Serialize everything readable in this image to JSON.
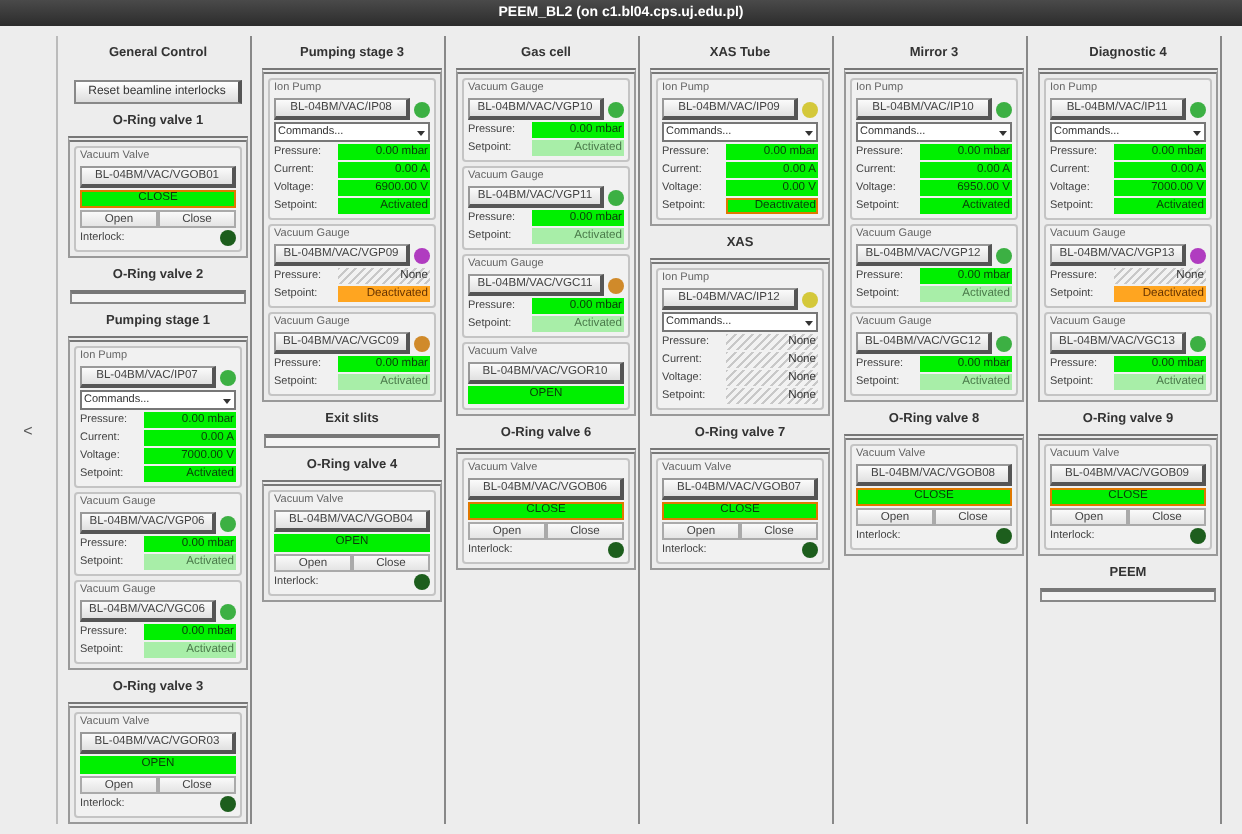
{
  "window": {
    "title": "PEEM_BL2 (on c1.bl04.cps.uj.edu.pl)"
  },
  "nav": {
    "left": "<"
  },
  "columns": [
    {
      "sections": [
        {
          "title": "General Control",
          "kind": "buttons",
          "buttons": [
            "Reset beamline interlocks"
          ]
        },
        {
          "title": "O-Ring valve 1",
          "kind": "devices",
          "devices": [
            {
              "kind": "valve",
              "label": "Vacuum Valve",
              "name": "BL-04BM/VAC/VGOB01",
              "status": "CLOSE",
              "flagged": true,
              "buttons": [
                "Open",
                "Close"
              ],
              "interlock": {
                "label": "Interlock:",
                "color": "#1d5e1d"
              }
            }
          ]
        },
        {
          "title": "O-Ring valve 2",
          "kind": "empty"
        },
        {
          "title": "Pumping stage 1",
          "kind": "devices",
          "devices": [
            {
              "kind": "ion_pump",
              "label": "Ion Pump",
              "name": "BL-04BM/VAC/IP07",
              "color": "#3cb043",
              "command": "Commands...",
              "readings": [
                {
                  "label": "Pressure:",
                  "value": "0.00 mbar",
                  "kind": "on",
                  "flagged": false
                },
                {
                  "label": "Current:",
                  "value": "0.00 A",
                  "kind": "on",
                  "flagged": false
                },
                {
                  "label": "Voltage:",
                  "value": "7000.00 V",
                  "kind": "on",
                  "flagged": false
                },
                {
                  "label": "Setpoint:",
                  "value": "Activated",
                  "kind": "on",
                  "flagged": false
                }
              ]
            },
            {
              "kind": "gauge",
              "label": "Vacuum Gauge",
              "name": "BL-04BM/VAC/VGP06",
              "color": "#3cb043",
              "readings": [
                {
                  "label": "Pressure:",
                  "value": "0.00 mbar",
                  "kind": "on",
                  "flagged": false
                },
                {
                  "label": "Setpoint:",
                  "value": "Activated",
                  "kind": "dim",
                  "flagged": false
                }
              ]
            },
            {
              "kind": "gauge",
              "label": "Vacuum Gauge",
              "name": "BL-04BM/VAC/VGC06",
              "color": "#3cb043",
              "readings": [
                {
                  "label": "Pressure:",
                  "value": "0.00 mbar",
                  "kind": "on",
                  "flagged": false
                },
                {
                  "label": "Setpoint:",
                  "value": "Activated",
                  "kind": "dim",
                  "flagged": false
                }
              ]
            }
          ]
        },
        {
          "title": "O-Ring valve 3",
          "kind": "devices",
          "devices": [
            {
              "kind": "valve",
              "label": "Vacuum Valve",
              "name": "BL-04BM/VAC/VGOR03",
              "status": "OPEN",
              "flagged": false,
              "buttons": [
                "Open",
                "Close"
              ],
              "interlock": {
                "label": "Interlock:",
                "color": "#1d5e1d"
              }
            }
          ]
        }
      ]
    },
    {
      "sections": [
        {
          "title": "Pumping stage 3",
          "kind": "devices",
          "devices": [
            {
              "kind": "ion_pump",
              "label": "Ion Pump",
              "name": "BL-04BM/VAC/IP08",
              "color": "#3cb043",
              "command": "Commands...",
              "readings": [
                {
                  "label": "Pressure:",
                  "value": "0.00 mbar",
                  "kind": "on",
                  "flagged": false
                },
                {
                  "label": "Current:",
                  "value": "0.00 A",
                  "kind": "on",
                  "flagged": false
                },
                {
                  "label": "Voltage:",
                  "value": "6900.00 V",
                  "kind": "on",
                  "flagged": false
                },
                {
                  "label": "Setpoint:",
                  "value": "Activated",
                  "kind": "on",
                  "flagged": false
                }
              ]
            },
            {
              "kind": "gauge",
              "label": "Vacuum Gauge",
              "name": "BL-04BM/VAC/VGP09",
              "color": "#b03cc0",
              "readings": [
                {
                  "label": "Pressure:",
                  "value": "None",
                  "kind": "none",
                  "flagged": false
                },
                {
                  "label": "Setpoint:",
                  "value": "Deactivated",
                  "kind": "alarm",
                  "flagged": false
                }
              ]
            },
            {
              "kind": "gauge",
              "label": "Vacuum Gauge",
              "name": "BL-04BM/VAC/VGC09",
              "color": "#d08a2a",
              "readings": [
                {
                  "label": "Pressure:",
                  "value": "0.00 mbar",
                  "kind": "on",
                  "flagged": false
                },
                {
                  "label": "Setpoint:",
                  "value": "Activated",
                  "kind": "dim",
                  "flagged": false
                }
              ]
            }
          ]
        },
        {
          "title": "Exit slits",
          "kind": "empty"
        },
        {
          "title": "O-Ring valve 4",
          "kind": "devices",
          "devices": [
            {
              "kind": "valve",
              "label": "Vacuum Valve",
              "name": "BL-04BM/VAC/VGOB04",
              "status": "OPEN",
              "flagged": false,
              "buttons": [
                "Open",
                "Close"
              ],
              "interlock": {
                "label": "Interlock:",
                "color": "#1d5e1d"
              }
            }
          ]
        }
      ]
    },
    {
      "sections": [
        {
          "title": "Gas cell",
          "kind": "devices",
          "devices": [
            {
              "kind": "gauge",
              "label": "Vacuum Gauge",
              "name": "BL-04BM/VAC/VGP10",
              "color": "#3cb043",
              "readings": [
                {
                  "label": "Pressure:",
                  "value": "0.00 mbar",
                  "kind": "on",
                  "flagged": false
                },
                {
                  "label": "Setpoint:",
                  "value": "Activated",
                  "kind": "dim",
                  "flagged": false
                }
              ]
            },
            {
              "kind": "gauge",
              "label": "Vacuum Gauge",
              "name": "BL-04BM/VAC/VGP11",
              "color": "#3cb043",
              "readings": [
                {
                  "label": "Pressure:",
                  "value": "0.00 mbar",
                  "kind": "on",
                  "flagged": false
                },
                {
                  "label": "Setpoint:",
                  "value": "Activated",
                  "kind": "dim",
                  "flagged": false
                }
              ]
            },
            {
              "kind": "gauge",
              "label": "Vacuum Gauge",
              "name": "BL-04BM/VAC/VGC11",
              "color": "#d08a2a",
              "readings": [
                {
                  "label": "Pressure:",
                  "value": "0.00 mbar",
                  "kind": "on",
                  "flagged": false
                },
                {
                  "label": "Setpoint:",
                  "value": "Activated",
                  "kind": "dim",
                  "flagged": false
                }
              ]
            },
            {
              "kind": "valve",
              "label": "Vacuum Valve",
              "name": "BL-04BM/VAC/VGOR10",
              "status": "OPEN",
              "flagged": false
            }
          ]
        },
        {
          "title": "O-Ring valve 6",
          "kind": "devices",
          "devices": [
            {
              "kind": "valve",
              "label": "Vacuum Valve",
              "name": "BL-04BM/VAC/VGOB06",
              "status": "CLOSE",
              "flagged": true,
              "buttons": [
                "Open",
                "Close"
              ],
              "interlock": {
                "label": "Interlock:",
                "color": "#1d5e1d"
              }
            }
          ]
        }
      ]
    },
    {
      "sections": [
        {
          "title": "XAS Tube",
          "kind": "devices",
          "devices": [
            {
              "kind": "ion_pump",
              "label": "Ion Pump",
              "name": "BL-04BM/VAC/IP09",
              "color": "#d4c83a",
              "command": "Commands...",
              "readings": [
                {
                  "label": "Pressure:",
                  "value": "0.00 mbar",
                  "kind": "on",
                  "flagged": false
                },
                {
                  "label": "Current:",
                  "value": "0.00 A",
                  "kind": "on",
                  "flagged": false
                },
                {
                  "label": "Voltage:",
                  "value": "0.00 V",
                  "kind": "on",
                  "flagged": false
                },
                {
                  "label": "Setpoint:",
                  "value": "Deactivated",
                  "kind": "on",
                  "flagged": true
                }
              ]
            }
          ]
        },
        {
          "title": "XAS",
          "kind": "devices",
          "devices": [
            {
              "kind": "ion_pump",
              "label": "Ion Pump",
              "name": "BL-04BM/VAC/IP12",
              "color": "#d4c83a",
              "command": "Commands...",
              "readings": [
                {
                  "label": "Pressure:",
                  "value": "None",
                  "kind": "none",
                  "flagged": false
                },
                {
                  "label": "Current:",
                  "value": "None",
                  "kind": "none",
                  "flagged": false
                },
                {
                  "label": "Voltage:",
                  "value": "None",
                  "kind": "none",
                  "flagged": false
                },
                {
                  "label": "Setpoint:",
                  "value": "None",
                  "kind": "none",
                  "flagged": false
                }
              ]
            }
          ]
        },
        {
          "title": "O-Ring valve 7",
          "kind": "devices",
          "devices": [
            {
              "kind": "valve",
              "label": "Vacuum Valve",
              "name": "BL-04BM/VAC/VGOB07",
              "status": "CLOSE",
              "flagged": true,
              "buttons": [
                "Open",
                "Close"
              ],
              "interlock": {
                "label": "Interlock:",
                "color": "#1d5e1d"
              }
            }
          ]
        }
      ]
    },
    {
      "sections": [
        {
          "title": "Mirror 3",
          "kind": "devices",
          "devices": [
            {
              "kind": "ion_pump",
              "label": "Ion Pump",
              "name": "BL-04BM/VAC/IP10",
              "color": "#3cb043",
              "command": "Commands...",
              "readings": [
                {
                  "label": "Pressure:",
                  "value": "0.00 mbar",
                  "kind": "on",
                  "flagged": false
                },
                {
                  "label": "Current:",
                  "value": "0.00 A",
                  "kind": "on",
                  "flagged": false
                },
                {
                  "label": "Voltage:",
                  "value": "6950.00 V",
                  "kind": "on",
                  "flagged": false
                },
                {
                  "label": "Setpoint:",
                  "value": "Activated",
                  "kind": "on",
                  "flagged": false
                }
              ]
            },
            {
              "kind": "gauge",
              "label": "Vacuum Gauge",
              "name": "BL-04BM/VAC/VGP12",
              "color": "#3cb043",
              "readings": [
                {
                  "label": "Pressure:",
                  "value": "0.00 mbar",
                  "kind": "on",
                  "flagged": false
                },
                {
                  "label": "Setpoint:",
                  "value": "Activated",
                  "kind": "dim",
                  "flagged": false
                }
              ]
            },
            {
              "kind": "gauge",
              "label": "Vacuum Gauge",
              "name": "BL-04BM/VAC/VGC12",
              "color": "#3cb043",
              "readings": [
                {
                  "label": "Pressure:",
                  "value": "0.00 mbar",
                  "kind": "on",
                  "flagged": false
                },
                {
                  "label": "Setpoint:",
                  "value": "Activated",
                  "kind": "dim",
                  "flagged": false
                }
              ]
            }
          ]
        },
        {
          "title": "O-Ring valve 8",
          "kind": "devices",
          "devices": [
            {
              "kind": "valve",
              "label": "Vacuum Valve",
              "name": "BL-04BM/VAC/VGOB08",
              "status": "CLOSE",
              "flagged": true,
              "buttons": [
                "Open",
                "Close"
              ],
              "interlock": {
                "label": "Interlock:",
                "color": "#1d5e1d"
              }
            }
          ]
        }
      ]
    },
    {
      "sections": [
        {
          "title": "Diagnostic 4",
          "kind": "devices",
          "devices": [
            {
              "kind": "ion_pump",
              "label": "Ion Pump",
              "name": "BL-04BM/VAC/IP11",
              "color": "#3cb043",
              "command": "Commands...",
              "readings": [
                {
                  "label": "Pressure:",
                  "value": "0.00 mbar",
                  "kind": "on",
                  "flagged": false
                },
                {
                  "label": "Current:",
                  "value": "0.00 A",
                  "kind": "on",
                  "flagged": false
                },
                {
                  "label": "Voltage:",
                  "value": "7000.00 V",
                  "kind": "on",
                  "flagged": false
                },
                {
                  "label": "Setpoint:",
                  "value": "Activated",
                  "kind": "on",
                  "flagged": false
                }
              ]
            },
            {
              "kind": "gauge",
              "label": "Vacuum Gauge",
              "name": "BL-04BM/VAC/VGP13",
              "color": "#b03cc0",
              "readings": [
                {
                  "label": "Pressure:",
                  "value": "None",
                  "kind": "none",
                  "flagged": false
                },
                {
                  "label": "Setpoint:",
                  "value": "Deactivated",
                  "kind": "alarm",
                  "flagged": false
                }
              ]
            },
            {
              "kind": "gauge",
              "label": "Vacuum Gauge",
              "name": "BL-04BM/VAC/VGC13",
              "color": "#3cb043",
              "readings": [
                {
                  "label": "Pressure:",
                  "value": "0.00 mbar",
                  "kind": "on",
                  "flagged": false
                },
                {
                  "label": "Setpoint:",
                  "value": "Activated",
                  "kind": "dim",
                  "flagged": false
                }
              ]
            }
          ]
        },
        {
          "title": "O-Ring valve 9",
          "kind": "devices",
          "devices": [
            {
              "kind": "valve",
              "label": "Vacuum Valve",
              "name": "BL-04BM/VAC/VGOB09",
              "status": "CLOSE",
              "flagged": true,
              "buttons": [
                "Open",
                "Close"
              ],
              "interlock": {
                "label": "Interlock:",
                "color": "#1d5e1d"
              }
            }
          ]
        },
        {
          "title": "PEEM",
          "kind": "empty"
        }
      ]
    }
  ]
}
